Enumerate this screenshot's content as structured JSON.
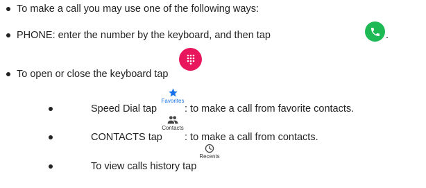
{
  "items": [
    {
      "text": "To make a call you may use one of the following ways:"
    },
    {
      "text": "PHONE: enter the number by the keyboard, and then tap",
      "suffix": "."
    },
    {
      "text": "To open or close the keyboard tap"
    }
  ],
  "subitems": [
    {
      "before": "Speed Dial tap",
      "icon_label": "Favorites",
      "after": ": to make a call from favorite contacts."
    },
    {
      "before": "CONTACTS tap",
      "icon_label": "Contacts",
      "after": ": to make a call from contacts."
    },
    {
      "before": "To view calls history tap",
      "icon_label": "Recents",
      "after": ""
    }
  ],
  "icons": {
    "call": {
      "name": "phone-icon",
      "color": "#1db954"
    },
    "dialpad": {
      "name": "dialpad-icon",
      "color": "#e8175d"
    },
    "favorites": {
      "name": "star-icon",
      "color": "#1a73e8"
    },
    "contacts": {
      "name": "people-icon",
      "color": "#444444"
    },
    "recents": {
      "name": "clock-icon",
      "color": "#444444"
    }
  }
}
